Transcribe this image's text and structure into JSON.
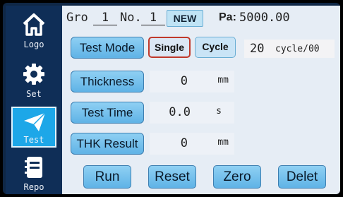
{
  "header": {
    "group_label": "Gro",
    "group_value": "1",
    "no_label": "No.",
    "no_value": "1",
    "new_label": "NEW",
    "pa_label": "Pa:",
    "pa_value": "5000.00"
  },
  "sidebar": {
    "items": [
      {
        "label": "Logo",
        "icon": "home-icon"
      },
      {
        "label": "Set",
        "icon": "gear-icon"
      },
      {
        "label": "Test",
        "icon": "paper-plane-icon",
        "active": true
      },
      {
        "label": "Repo",
        "icon": "notebook-icon"
      }
    ]
  },
  "mode": {
    "label": "Test Mode",
    "single": "Single",
    "cycle": "Cycle",
    "cycle_count": "20",
    "cycle_unit": "cycle/00"
  },
  "rows": [
    {
      "label": "Thickness",
      "value": "0",
      "unit": "mm"
    },
    {
      "label": "Test Time",
      "value": "0.0",
      "unit": "s"
    },
    {
      "label": "THK Result",
      "value": "0",
      "unit": "mm"
    }
  ],
  "actions": {
    "run": "Run",
    "reset": "Reset",
    "zero": "Zero",
    "delet": "Delet"
  },
  "colors": {
    "sidebar_bg": "#0f2e57",
    "active_item": "#1da7e8",
    "button_blue": "#6cbdea",
    "panel": "#e6edf5"
  }
}
